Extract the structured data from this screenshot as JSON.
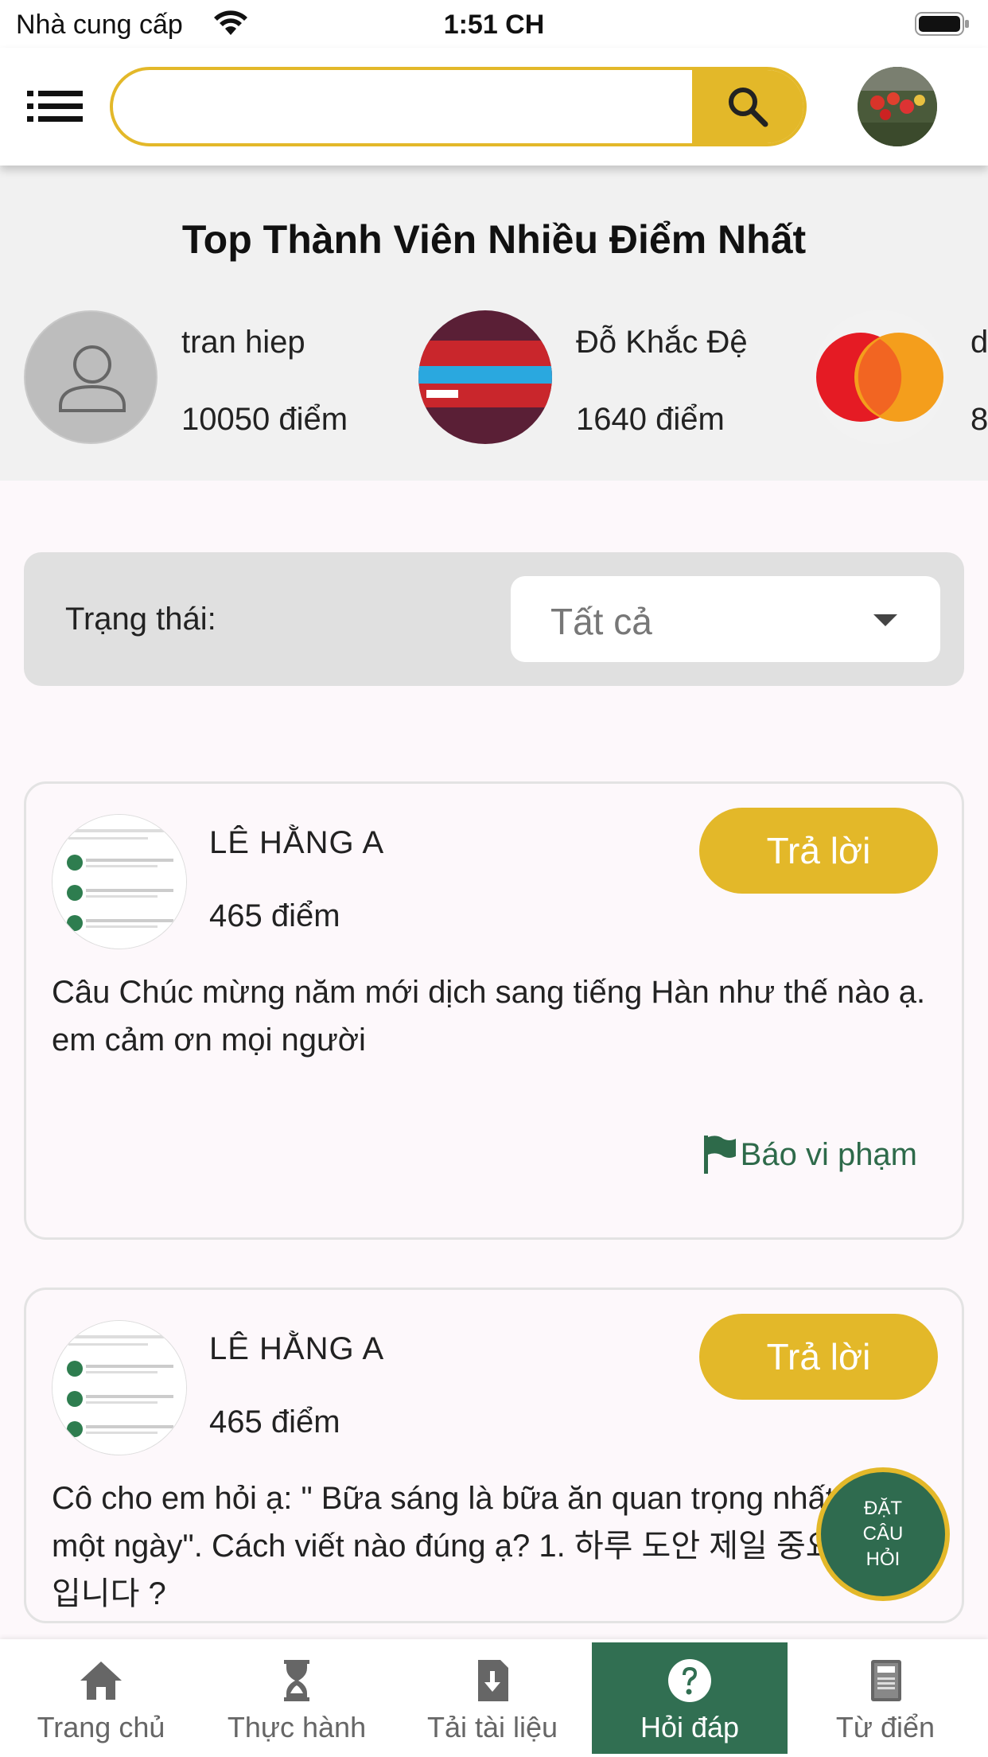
{
  "status_bar": {
    "carrier": "Nhà cung cấp",
    "time": "1:51 CH"
  },
  "header": {
    "menu_icon": "list-icon",
    "search_placeholder": "",
    "search_icon": "search-icon",
    "accent_color": "#e3b829"
  },
  "top_members": {
    "title": "Top Thành Viên Nhiều Điểm Nhất",
    "members": [
      {
        "name": "tran hiep",
        "score": "10050 điểm"
      },
      {
        "name": "Đỗ Khắc Đệ",
        "score": "1640 điểm"
      },
      {
        "name": "d",
        "score": "8"
      }
    ]
  },
  "filter": {
    "label": "Trạng thái:",
    "value": "Tất cả"
  },
  "questions": [
    {
      "author": "LÊ HẰNG A",
      "score": "465 điểm",
      "reply_label": "Trả lời",
      "text": " Câu Chúc mừng năm mới dịch sang tiếng Hàn như thế nào ạ. em cảm ơn mọi người",
      "report_label": "Báo vi phạm"
    },
    {
      "author": "LÊ HẰNG A",
      "score": "465 điểm",
      "reply_label": "Trả lời",
      "text": " Cô cho em hỏi ạ: \" Bữa sáng là bữa ăn quan trọng nhất trong một ngày\". Cách viết nào đúng ạ? 1. 하루 도안 제일 중요한 식사입니다 ?",
      "report_label": "Báo vi phạm"
    }
  ],
  "fab": {
    "label": "ĐẶT CÂU HỎI"
  },
  "bottom_nav": {
    "items": [
      {
        "label": "Trang chủ",
        "icon": "home-icon"
      },
      {
        "label": "Thực hành",
        "icon": "hourglass-icon"
      },
      {
        "label": "Tải tài liệu",
        "icon": "download-doc-icon"
      },
      {
        "label": "Hỏi đáp",
        "icon": "question-icon",
        "active": true
      },
      {
        "label": "Từ điển",
        "icon": "dictionary-icon"
      }
    ],
    "active_color": "#316f52"
  }
}
